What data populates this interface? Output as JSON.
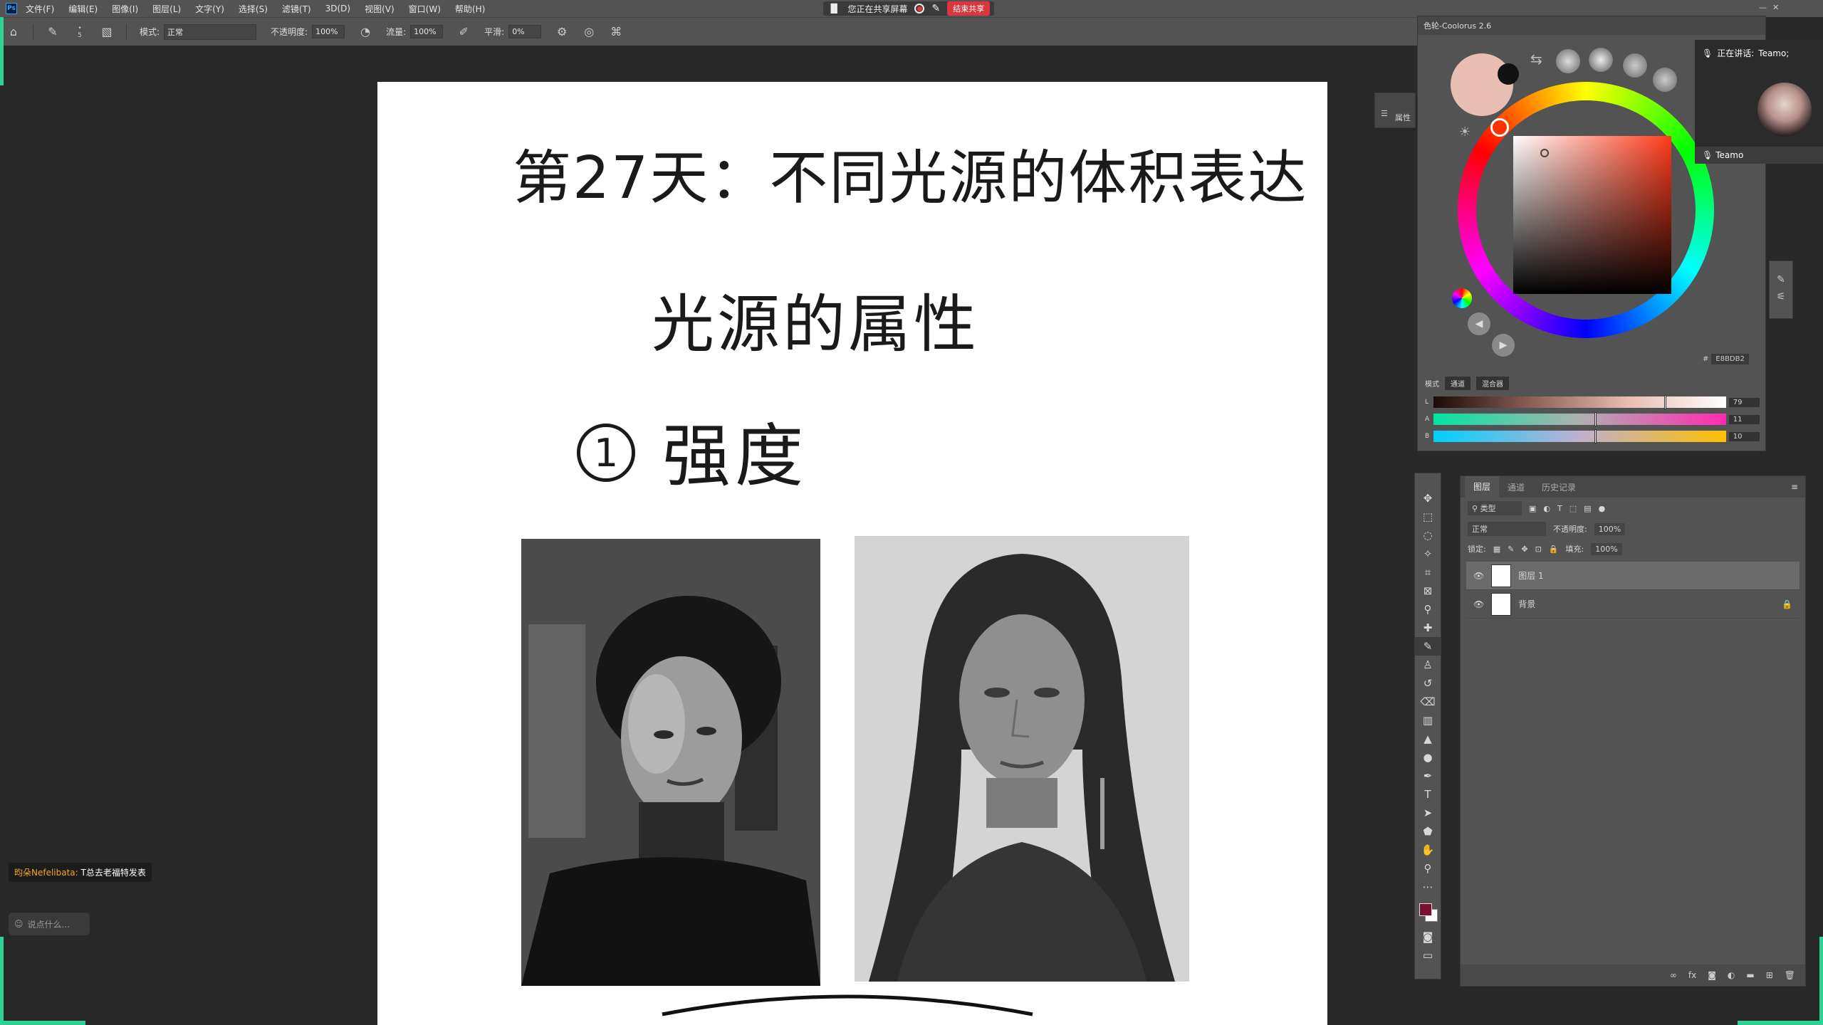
{
  "menubar": {
    "app_icon": "Ps",
    "items": [
      "文件(F)",
      "编辑(E)",
      "图像(I)",
      "图层(L)",
      "文字(Y)",
      "选择(S)",
      "滤镜(T)",
      "3D(D)",
      "视图(V)",
      "窗口(W)",
      "帮助(H)"
    ]
  },
  "share": {
    "status": "您正在共享屏幕",
    "end_label": "结束共享"
  },
  "options": {
    "brush_size": "5",
    "mode_label": "模式:",
    "mode_value": "正常",
    "opacity_label": "不透明度:",
    "opacity_value": "100%",
    "flow_label": "流量:",
    "flow_value": "100%",
    "smooth_label": "平滑:",
    "smooth_value": "0%"
  },
  "canvas": {
    "title": "第27天：不同光源的体积表达",
    "subtitle": "光源的属性",
    "point_number": "1",
    "point_text": "强度"
  },
  "properties_tab": {
    "label": "属性"
  },
  "color_panel": {
    "title": "色轮-Coolorus 2.6",
    "hex": "E8BDB2",
    "mode_label": "模式",
    "mode_tabs": [
      "通道",
      "混合器"
    ],
    "sliders": [
      {
        "label": "L",
        "value": "79",
        "fraction": 0.79
      },
      {
        "label": "A",
        "value": "11",
        "fraction": 0.55
      },
      {
        "label": "B",
        "value": "10",
        "fraction": 0.55
      }
    ],
    "current_color": "#e8bdb2",
    "secondary_color": "#111111"
  },
  "meeting": {
    "speaking_label": "正在讲话:",
    "speaker": "Teamo;",
    "name_tag": "Teamo"
  },
  "layers_panel": {
    "tabs": [
      "图层",
      "通道",
      "历史记录"
    ],
    "filter_label": "类型",
    "blend_mode": "正常",
    "opacity_label": "不透明度:",
    "opacity_value": "100%",
    "lock_label": "锁定:",
    "fill_label": "填充:",
    "fill_value": "100%",
    "layers": [
      {
        "name": "图层 1"
      },
      {
        "name": "背景"
      }
    ]
  },
  "tools": [
    "move-tool",
    "marquee-tool",
    "lasso-tool",
    "magic-wand-tool",
    "crop-tool",
    "frame-tool",
    "eyedropper-tool",
    "healing-tool",
    "brush-tool",
    "stamp-tool",
    "history-brush-tool",
    "eraser-tool",
    "gradient-tool",
    "blur-tool",
    "dodge-tool",
    "pen-tool",
    "type-tool",
    "path-select-tool",
    "shape-tool",
    "hand-tool",
    "zoom-tool",
    "more-tool"
  ],
  "foreground_color": "#7a0f2e",
  "background_color": "#ffffff",
  "chat": {
    "user": "昀朵Nefelibata:",
    "message": "T总去老福特发表",
    "input_placeholder": "说点什么..."
  }
}
